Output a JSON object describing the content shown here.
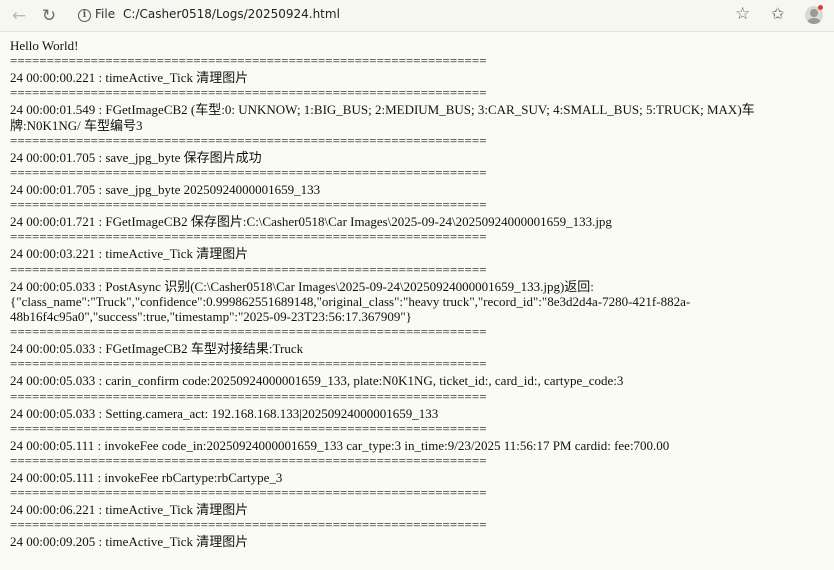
{
  "browser": {
    "scheme_label": "File",
    "url": "C:/Casher0518/Logs/20250924.html"
  },
  "page": {
    "greeting": "Hello World!",
    "separator": "=================================================================",
    "entries": [
      "24 00:00:00.221 : timeActive_Tick 清理图片",
      "24 00:00:01.549 : FGetImageCB2 (车型:0: UNKNOW; 1:BIG_BUS; 2:MEDIUM_BUS; 3:CAR_SUV; 4:SMALL_BUS; 5:TRUCK; MAX)车牌:N0K1NG/ 车型编号3",
      "24 00:00:01.705 : save_jpg_byte 保存图片成功",
      "24 00:00:01.705 : save_jpg_byte 20250924000001659_133",
      "24 00:00:01.721 : FGetImageCB2 保存图片:C:\\Casher0518\\Car Images\\2025-09-24\\20250924000001659_133.jpg",
      "24 00:00:03.221 : timeActive_Tick 清理图片",
      "24 00:00:05.033 : PostAsync 识别(C:\\Casher0518\\Car Images\\2025-09-24\\20250924000001659_133.jpg)返回: {\"class_name\":\"Truck\",\"confidence\":0.999862551689148,\"original_class\":\"heavy truck\",\"record_id\":\"8e3d2d4a-7280-421f-882a-48b16f4c95a0\",\"success\":true,\"timestamp\":\"2025-09-23T23:56:17.367909\"}",
      "24 00:00:05.033 : FGetImageCB2 车型对接结果:Truck",
      "24 00:00:05.033 : carin_confirm code:20250924000001659_133, plate:N0K1NG, ticket_id:, card_id:, cartype_code:3",
      "24 00:00:05.033 : Setting.camera_act: 192.168.168.133|20250924000001659_133",
      "24 00:00:05.111 : invokeFee code_in:20250924000001659_133 car_type:3 in_time:9/23/2025 11:56:17 PM cardid: fee:700.00",
      "24 00:00:05.111 : invokeFee rbCartype:rbCartype_3",
      "24 00:00:06.221 : timeActive_Tick 清理图片",
      "24 00:00:09.205 : timeActive_Tick 清理图片"
    ]
  }
}
